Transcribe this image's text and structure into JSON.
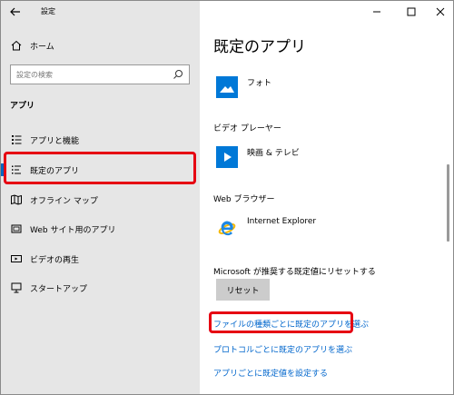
{
  "window": {
    "title": "設定"
  },
  "nav": {
    "home_label": "ホーム",
    "search_placeholder": "設定の検索",
    "section_label": "アプリ",
    "items": [
      {
        "label": "アプリと機能",
        "icon": "apps-features-icon"
      },
      {
        "label": "既定のアプリ",
        "icon": "default-apps-icon"
      },
      {
        "label": "オフライン マップ",
        "icon": "offline-maps-icon"
      },
      {
        "label": "Web サイト用のアプリ",
        "icon": "apps-for-websites-icon"
      },
      {
        "label": "ビデオの再生",
        "icon": "video-playback-icon"
      },
      {
        "label": "スタートアップ",
        "icon": "startup-icon"
      }
    ],
    "selected_index": 1
  },
  "main": {
    "title": "既定のアプリ",
    "photos_app": "フォト",
    "video_player_label": "ビデオ プレーヤー",
    "video_app": "映画 & テレビ",
    "web_browser_label": "Web ブラウザー",
    "browser_app": "Internet Explorer",
    "reset_text": "Microsoft が推奨する既定値にリセットする",
    "reset_button": "リセット",
    "links": [
      "ファイルの種類ごとに既定のアプリを選ぶ",
      "プロトコルごとに既定のアプリを選ぶ",
      "アプリごとに既定値を設定する"
    ]
  },
  "colors": {
    "accent": "#0067c0",
    "highlight": "#e60012",
    "link": "#0066cc"
  }
}
